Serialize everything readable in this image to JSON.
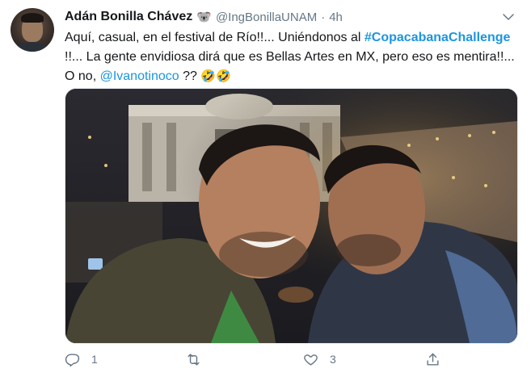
{
  "author": {
    "name": "Adán Bonilla Chávez",
    "badge_icon": "koala-emoji",
    "handle": "@IngBonillaUNAM",
    "separator": "·",
    "time": "4h"
  },
  "tweet": {
    "line1_pre": "Aquí, casual, en el festival de Río!!... Uniéndonos al ",
    "hashtag": "#CopacabanaChallenge",
    "line2": " !!... La gente  envidiosa dirá que es Bellas Artes en MX, pero eso es mentira!!... O no, ",
    "mention": "@Ivanotinoco",
    "line3_post": " ?? ",
    "emojis": "🤣🤣"
  },
  "actions": {
    "reply_count": "1",
    "retweet_count": "",
    "like_count": "3",
    "share_count": ""
  },
  "icons": [
    "caret-down-icon",
    "reply-icon",
    "retweet-icon",
    "like-icon",
    "share-icon"
  ],
  "colors": {
    "link": "#1b95e0",
    "secondary_text": "#657786",
    "primary_text": "#14171a"
  }
}
